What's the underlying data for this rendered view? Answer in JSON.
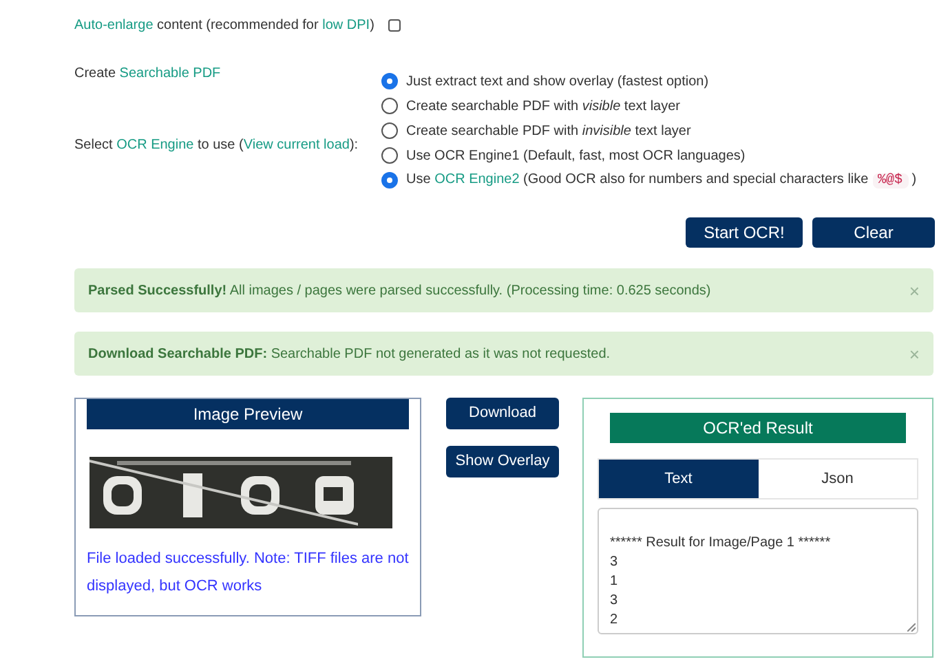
{
  "auto_enlarge": {
    "label": [
      {
        "kind": "link",
        "text": "Auto-enlarge"
      },
      {
        "kind": "text",
        "text": " content (recommended for "
      },
      {
        "kind": "link",
        "text": "low DPI"
      },
      {
        "kind": "text",
        "text": ")"
      }
    ],
    "checked": false
  },
  "pdf_label": [
    {
      "kind": "text",
      "text": "Create "
    },
    {
      "kind": "link",
      "text": "Searchable PDF"
    }
  ],
  "engine_label": [
    {
      "kind": "text",
      "text": "Select "
    },
    {
      "kind": "link",
      "text": "OCR Engine"
    },
    {
      "kind": "text",
      "text": " to use ("
    },
    {
      "kind": "link",
      "text": "View current load"
    },
    {
      "kind": "text",
      "text": "):"
    }
  ],
  "pdf_options": [
    {
      "selected": true,
      "label": [
        {
          "kind": "text",
          "text": "Just extract text and show overlay (fastest option)"
        }
      ]
    },
    {
      "selected": false,
      "label": [
        {
          "kind": "text",
          "text": "Create searchable PDF with *visible* text layer"
        }
      ]
    },
    {
      "selected": false,
      "label": [
        {
          "kind": "text",
          "text": "Create searchable PDF with *invisible* text layer"
        }
      ]
    }
  ],
  "engine_options": [
    {
      "selected": false,
      "label": [
        {
          "kind": "text",
          "text": "Use OCR Engine1 (Default, fast, most OCR languages)"
        }
      ]
    },
    {
      "selected": true,
      "label": [
        {
          "kind": "text",
          "text": "Use "
        },
        {
          "kind": "link",
          "text": "OCR Engine2"
        },
        {
          "kind": "text",
          "text": " (Good OCR also for numbers and special characters like "
        },
        {
          "kind": "code",
          "text": "%@$"
        },
        {
          "kind": "text",
          "text": " )"
        }
      ]
    }
  ],
  "actions": [
    "Start OCR!",
    "Clear"
  ],
  "alerts": [
    {
      "title": "Parsed Successfully!",
      "message": "All images / pages were parsed successfully. (Processing time: 0.625 seconds)",
      "close": "×"
    },
    {
      "title": "Download Searchable PDF:",
      "message": "Searchable PDF not generated as it was not requested.",
      "close": "×"
    }
  ],
  "preview": {
    "title": "Image Preview",
    "note": "File loaded successfully. Note: TIFF files are not displayed, but OCR works"
  },
  "middle_buttons": [
    "Download",
    "Show Overlay"
  ],
  "result": {
    "title": "OCR'ed Result",
    "tabs": [
      {
        "label": "Text",
        "selected": true
      },
      {
        "label": "Json",
        "selected": false
      }
    ],
    "lines": [
      "****** Result for Image/Page 1 ******",
      "3",
      "1",
      "3",
      "2"
    ]
  }
}
